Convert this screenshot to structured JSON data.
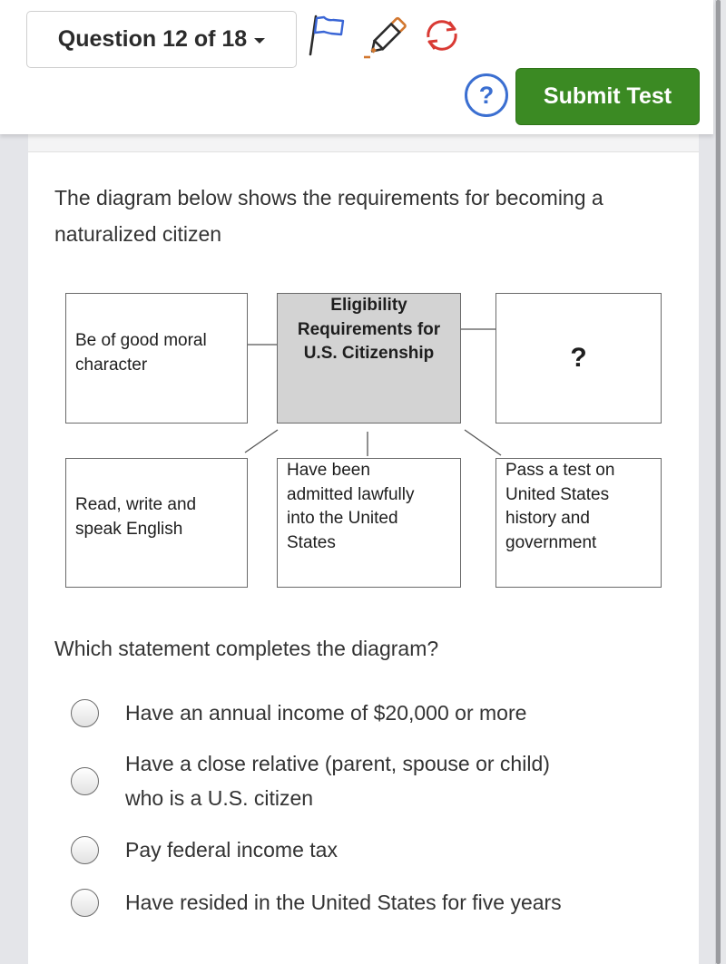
{
  "toolbar": {
    "question_selector": "Question 12 of 18",
    "icons": {
      "flag": "flag-icon",
      "pencil": "pencil-icon",
      "refresh": "refresh-icon",
      "help": "help-icon"
    },
    "help_label": "?",
    "submit_label": "Submit Test",
    "colors": {
      "submit_bg": "#3b8a23",
      "help_blue": "#3b6fd1",
      "flag_blue": "#3a66d6",
      "pencil_orange": "#d2772f",
      "refresh_red": "#d93a34"
    }
  },
  "content": {
    "prompt": "The diagram below shows the requirements for becoming a naturalized citizen",
    "diagram": {
      "center": [
        "Eligibility",
        "Requirements for",
        "U.S. Citizenship"
      ],
      "boxes": {
        "top_left": [
          "Be of good moral",
          "character"
        ],
        "top_right": "?",
        "bottom_left": [
          "Read, write and",
          "speak English"
        ],
        "bottom_middle": [
          "Have been",
          "admitted lawfully",
          "into the United",
          "States"
        ],
        "bottom_right": [
          "Pass a test on",
          "United States",
          "history and",
          "government"
        ]
      }
    },
    "question": "Which statement completes the diagram?",
    "options": [
      {
        "label": "Have an annual income of $20,000 or more",
        "selected": false
      },
      {
        "label": "Have a close relative (parent, spouse or child) who is a U.S. citizen",
        "label_lines": [
          "Have a close relative (parent, spouse or child)",
          "who is a U.S. citizen"
        ],
        "selected": false
      },
      {
        "label": "Pay federal income tax",
        "selected": false
      },
      {
        "label": "Have resided in the United States for five years",
        "selected": false
      }
    ]
  }
}
